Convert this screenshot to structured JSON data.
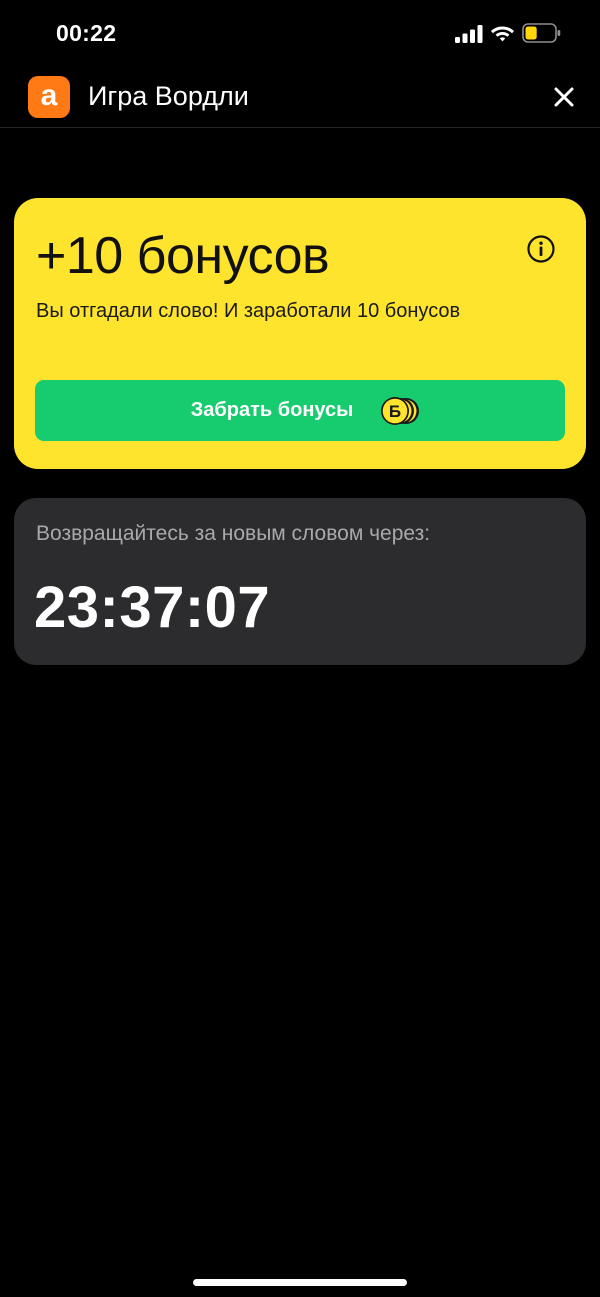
{
  "status_bar": {
    "time": "00:22",
    "icons": [
      "signal-icon",
      "wifi-icon",
      "battery-icon"
    ],
    "battery_level": 0.4,
    "battery_color": "#ffd60a"
  },
  "header": {
    "logo_letter": "a",
    "logo_color": "#ff7a14",
    "title": "Игра Вордли",
    "close_icon": "close-icon"
  },
  "bonus_card": {
    "background": "#ffe42e",
    "title": "+10 бонусов",
    "subtitle": "Вы отгадали слово! И заработали 10 бонусов",
    "info_icon": "info-icon",
    "claim_button": {
      "label": "Забрать бонусы",
      "color": "#17cc6f",
      "coin_letter": "Б"
    }
  },
  "countdown_card": {
    "label": "Возвращайтесь за новым словом через:",
    "timer": "23:37:07"
  }
}
